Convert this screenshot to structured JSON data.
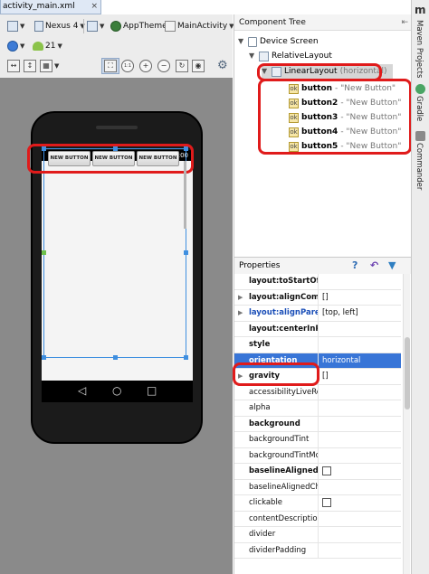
{
  "file_tab": {
    "title": "activity_main.xml",
    "close": "×"
  },
  "toolbar": {
    "device": "Nexus 4",
    "api": "21",
    "theme": "AppTheme",
    "activity": "MainActivity",
    "zoom_actual": "1:1",
    "zoom_in": "+",
    "zoom_out": "−",
    "refresh": "↻"
  },
  "phone": {
    "time": "5:00",
    "status_icons": "▼◢",
    "buttons": [
      "NEW BUTTON",
      "NEW BUTTON",
      "NEW BUTTON"
    ],
    "nav": [
      "◁",
      "○",
      "□"
    ]
  },
  "component_tree": {
    "header": "Component Tree",
    "hide": "⇤",
    "nodes": [
      {
        "label": "Device Screen",
        "sub": ""
      },
      {
        "label": "RelativeLayout",
        "sub": ""
      },
      {
        "label": "LinearLayout",
        "sub": "(horizontal)"
      },
      {
        "label": "button",
        "sub": "- \"New Button\""
      },
      {
        "label": "button2",
        "sub": "- \"New Button\""
      },
      {
        "label": "button3",
        "sub": "- \"New Button\""
      },
      {
        "label": "button4",
        "sub": "- \"New Button\""
      },
      {
        "label": "button5",
        "sub": "- \"New Button\""
      }
    ]
  },
  "properties": {
    "header": "Properties",
    "help": "?",
    "rows": [
      {
        "name": "layout:toStartOf",
        "value": ""
      },
      {
        "name": "layout:alignCompo",
        "value": "[]"
      },
      {
        "name": "layout:alignParent",
        "value": "[top, left]"
      },
      {
        "name": "layout:centerInPar",
        "value": ""
      },
      {
        "name": "style",
        "value": ""
      },
      {
        "name": "orientation",
        "value": "horizontal"
      },
      {
        "name": "gravity",
        "value": "[]"
      },
      {
        "name": "accessibilityLiveReg",
        "value": ""
      },
      {
        "name": "alpha",
        "value": ""
      },
      {
        "name": "background",
        "value": ""
      },
      {
        "name": "backgroundTint",
        "value": ""
      },
      {
        "name": "backgroundTintMo",
        "value": ""
      },
      {
        "name": "baselineAligned",
        "value": ""
      },
      {
        "name": "baselineAlignedChi",
        "value": ""
      },
      {
        "name": "clickable",
        "value": ""
      },
      {
        "name": "contentDescription",
        "value": ""
      },
      {
        "name": "divider",
        "value": ""
      },
      {
        "name": "dividerPadding",
        "value": ""
      }
    ]
  },
  "side_strip": {
    "tabs": [
      "Maven Projects",
      "Gradle",
      "Commander"
    ],
    "logo": "m"
  }
}
